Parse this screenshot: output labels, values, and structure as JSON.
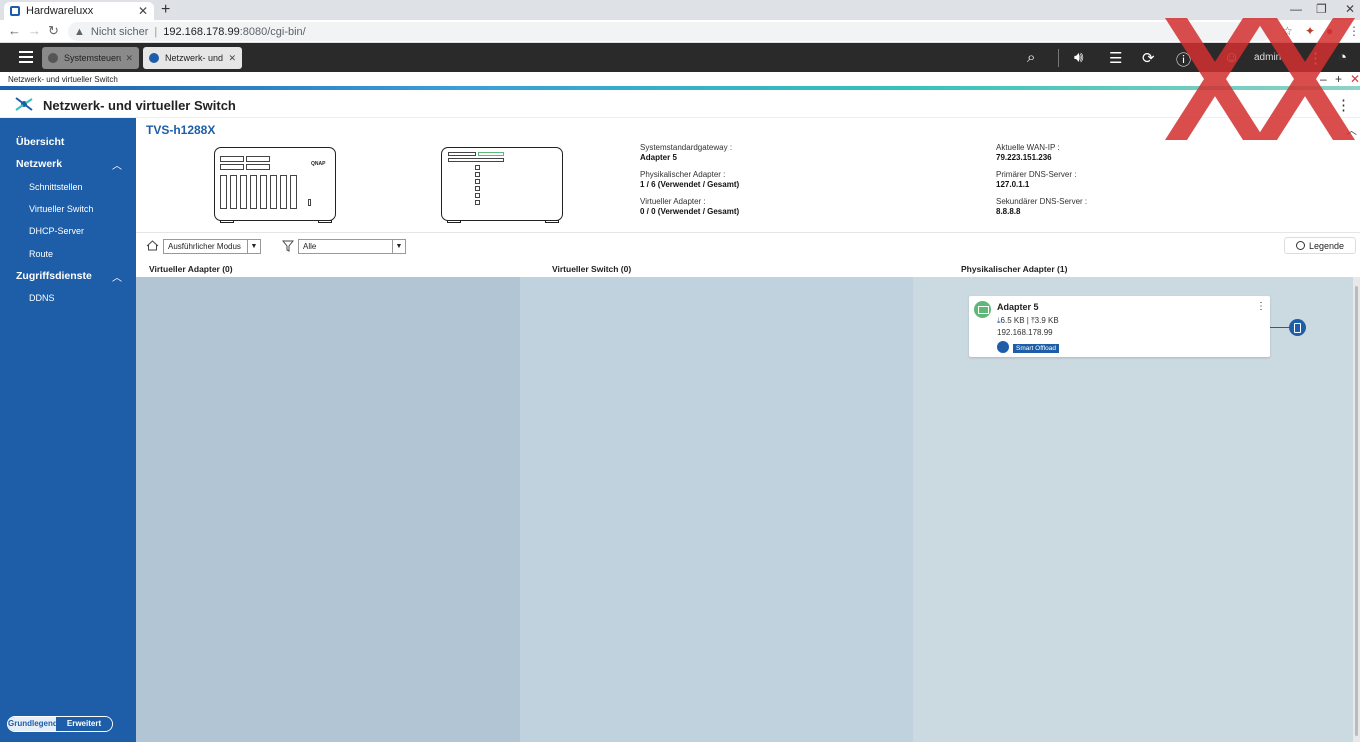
{
  "browser": {
    "tab_title": "Hardwareluxx",
    "security_label": "Nicht sicher",
    "url_host": "192.168.178.99",
    "url_path": ":8080/cgi-bin/"
  },
  "qts": {
    "tabs": [
      {
        "label": "Systemsteuerung"
      },
      {
        "label": "Netzwerk- und ..."
      }
    ],
    "user": "admin"
  },
  "window": {
    "title": "Netzwerk- und virtueller Switch"
  },
  "app": {
    "title": "Netzwerk- und virtueller Switch"
  },
  "sidebar": {
    "overview": "Übersicht",
    "network": "Netzwerk",
    "network_items": [
      "Schnittstellen",
      "Virtueller Switch",
      "DHCP-Server",
      "Route"
    ],
    "access": "Zugriffsdienste",
    "access_items": [
      "DDNS"
    ],
    "mode_basic": "Grundlegend",
    "mode_advanced": "Erweitert"
  },
  "device": {
    "name": "TVS-h1288X",
    "brand": "QNAP"
  },
  "info": {
    "gateway_label": "Systemstandardgateway :",
    "gateway_value": "Adapter 5",
    "phys_label": "Physikalischer Adapter :",
    "phys_value": "1 / 6 (Verwendet / Gesamt)",
    "virt_label": "Virtueller Adapter :",
    "virt_value": "0 / 0 (Verwendet / Gesamt)",
    "wan_label": "Aktuelle WAN-IP :",
    "wan_value": "79.223.151.236",
    "dns1_label": "Primärer DNS-Server :",
    "dns1_value": "127.0.1.1",
    "dns2_label": "Sekundärer DNS-Server :",
    "dns2_value": "8.8.8.8"
  },
  "toolbar": {
    "mode_select": "Ausführlicher Modus",
    "filter_select": "Alle",
    "legend": "Legende"
  },
  "columns": {
    "virtual_adapter": "Virtueller Adapter (0)",
    "virtual_switch": "Virtueller Switch (0)",
    "physical_adapter": "Physikalischer Adapter (1)"
  },
  "adapter_card": {
    "name": "Adapter 5",
    "download": "6.5 KB",
    "upload": "3.9 KB",
    "ip": "192.168.178.99",
    "badge": "Smart Offload"
  },
  "colors": {
    "accent": "#1e5ea8",
    "sidebar": "#1e5ea8",
    "topbar": "#2a2a2a",
    "status_ok": "#5fb878"
  }
}
